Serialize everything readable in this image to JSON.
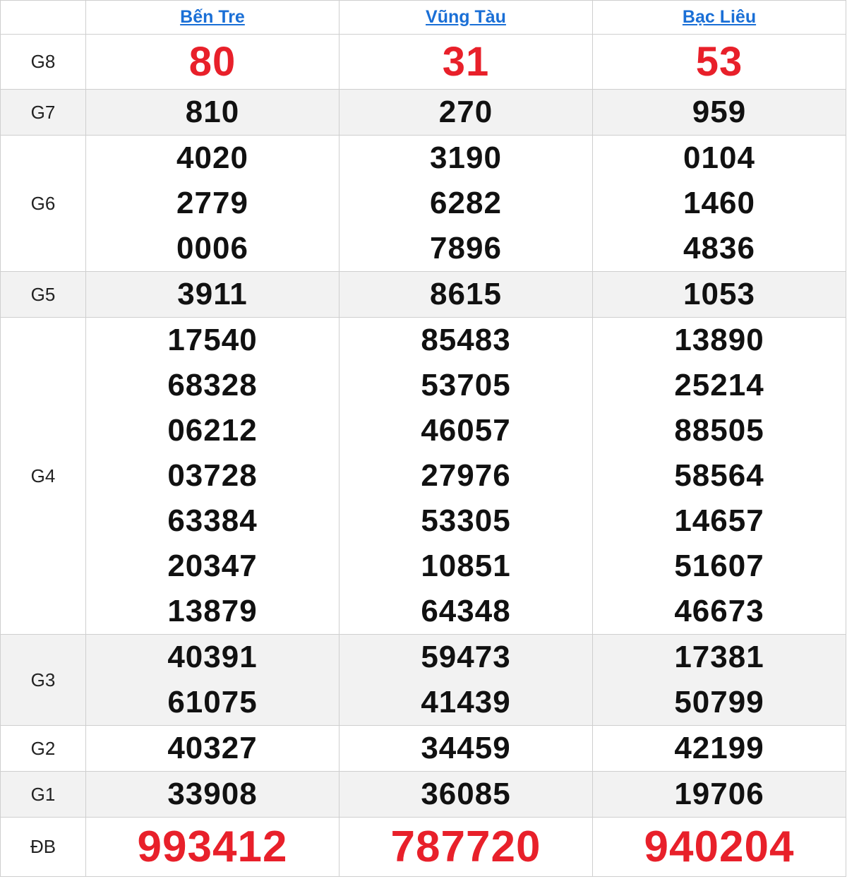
{
  "provinces": [
    "Bến Tre",
    "Vũng Tàu",
    "Bạc Liêu"
  ],
  "accent_color": "#e8202a",
  "link_color": "#1a6fd6",
  "rows": [
    {
      "label": "G8",
      "style": "red",
      "values": [
        [
          "80"
        ],
        [
          "31"
        ],
        [
          "53"
        ]
      ]
    },
    {
      "label": "G7",
      "values": [
        [
          "810"
        ],
        [
          "270"
        ],
        [
          "959"
        ]
      ]
    },
    {
      "label": "G6",
      "values": [
        [
          "4020",
          "2779",
          "0006"
        ],
        [
          "3190",
          "6282",
          "7896"
        ],
        [
          "0104",
          "1460",
          "4836"
        ]
      ]
    },
    {
      "label": "G5",
      "values": [
        [
          "3911"
        ],
        [
          "8615"
        ],
        [
          "1053"
        ]
      ]
    },
    {
      "label": "G4",
      "values": [
        [
          "17540",
          "68328",
          "06212",
          "03728",
          "63384",
          "20347",
          "13879"
        ],
        [
          "85483",
          "53705",
          "46057",
          "27976",
          "53305",
          "10851",
          "64348"
        ],
        [
          "13890",
          "25214",
          "88505",
          "58564",
          "14657",
          "51607",
          "46673"
        ]
      ]
    },
    {
      "label": "G3",
      "values": [
        [
          "40391",
          "61075"
        ],
        [
          "59473",
          "41439"
        ],
        [
          "17381",
          "50799"
        ]
      ]
    },
    {
      "label": "G2",
      "values": [
        [
          "40327"
        ],
        [
          "34459"
        ],
        [
          "42199"
        ]
      ]
    },
    {
      "label": "G1",
      "values": [
        [
          "33908"
        ],
        [
          "36085"
        ],
        [
          "19706"
        ]
      ]
    },
    {
      "label": "ĐB",
      "style": "big",
      "values": [
        [
          "993412"
        ],
        [
          "787720"
        ],
        [
          "940204"
        ]
      ]
    }
  ]
}
